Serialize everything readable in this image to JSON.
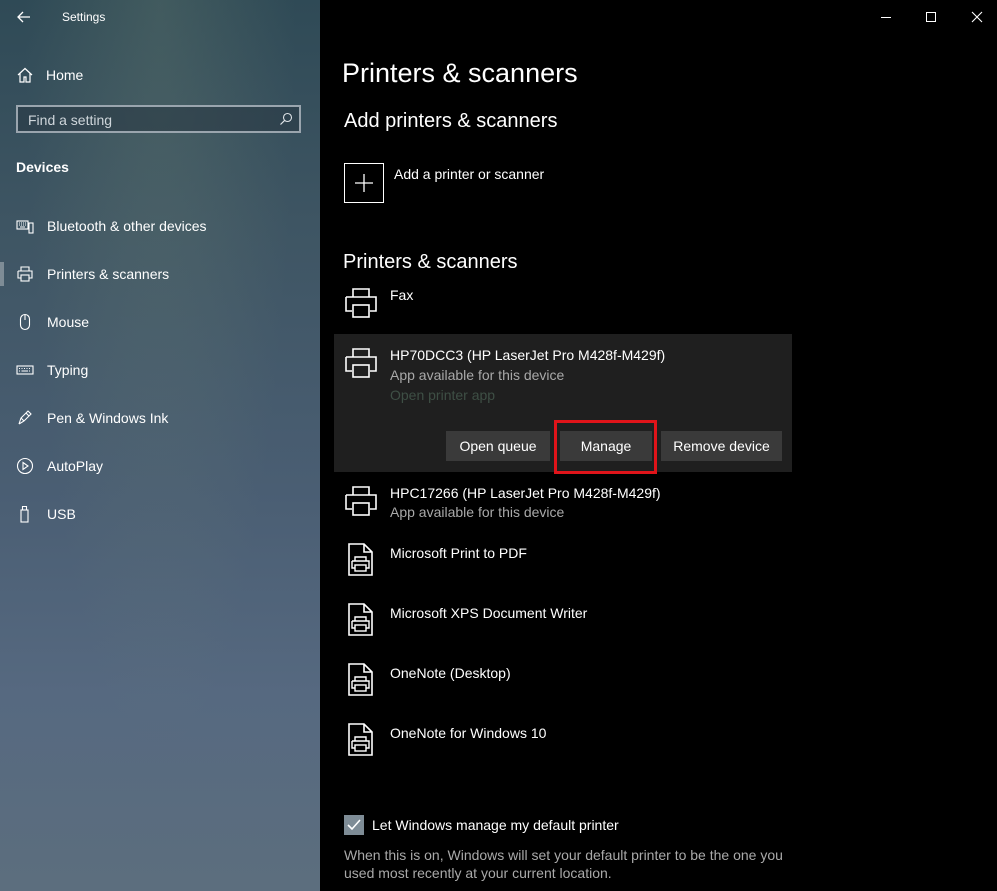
{
  "window": {
    "app_title": "Settings",
    "controls": {
      "minimize": "minimize-icon",
      "maximize": "maximize-icon",
      "close": "close-icon"
    }
  },
  "sidebar": {
    "home_label": "Home",
    "search_placeholder": "Find a setting",
    "section_title": "Devices",
    "items": [
      {
        "label": "Bluetooth & other devices",
        "icon": "bluetooth-devices-icon",
        "selected": false
      },
      {
        "label": "Printers & scanners",
        "icon": "printer-icon",
        "selected": true
      },
      {
        "label": "Mouse",
        "icon": "mouse-icon",
        "selected": false
      },
      {
        "label": "Typing",
        "icon": "keyboard-icon",
        "selected": false
      },
      {
        "label": "Pen & Windows Ink",
        "icon": "pen-icon",
        "selected": false
      },
      {
        "label": "AutoPlay",
        "icon": "autoplay-icon",
        "selected": false
      },
      {
        "label": "USB",
        "icon": "usb-icon",
        "selected": false
      }
    ]
  },
  "main": {
    "page_title": "Printers & scanners",
    "add_section_title": "Add printers & scanners",
    "add_label": "Add a printer or scanner",
    "list_title": "Printers & scanners",
    "devices": [
      {
        "name": "Fax",
        "icon": "printer-icon"
      },
      {
        "name": "HP70DCC3 (HP LaserJet Pro M428f-M429f)",
        "status": "App available for this device",
        "link": "Open printer app",
        "icon": "printer-icon",
        "expanded": true
      },
      {
        "name": "HPC17266 (HP LaserJet Pro M428f-M429f)",
        "status": "App available for this device",
        "icon": "printer-icon"
      },
      {
        "name": "Microsoft Print to PDF",
        "icon": "document-printer-icon"
      },
      {
        "name": "Microsoft XPS Document Writer",
        "icon": "document-printer-icon"
      },
      {
        "name": "OneNote (Desktop)",
        "icon": "document-printer-icon"
      },
      {
        "name": "OneNote for Windows 10",
        "icon": "document-printer-icon"
      }
    ],
    "actions": {
      "open_queue": "Open queue",
      "manage": "Manage",
      "remove": "Remove device"
    },
    "default_printer": {
      "checked": true,
      "label": "Let Windows manage my default printer",
      "description": "When this is on, Windows will set your default printer to be the one you used most recently at your current location."
    }
  },
  "colors": {
    "highlight": "#e0141a",
    "checkbox": "#7e8c96",
    "button": "#3a3a3a",
    "expanded_bg": "#1f1f1f"
  }
}
